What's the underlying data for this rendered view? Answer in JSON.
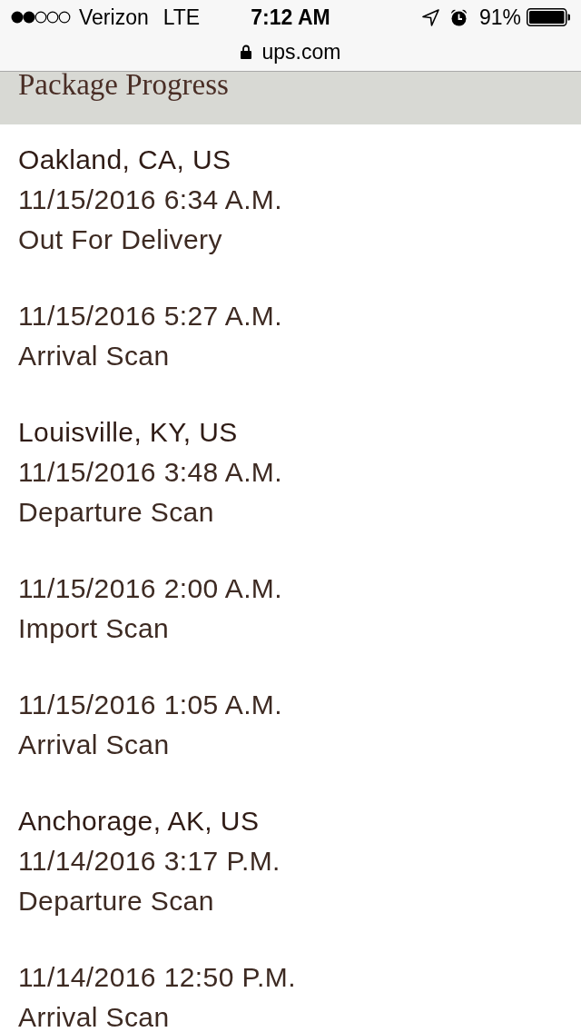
{
  "status_bar": {
    "carrier": "Verizon",
    "network": "LTE",
    "time": "7:12 AM",
    "battery": "91%"
  },
  "address_bar": {
    "url": "ups.com"
  },
  "section": {
    "title": "Package Progress"
  },
  "events": [
    {
      "location": "Oakland, CA, US",
      "datetime": "11/15/2016 6:34 A.M.",
      "status": "Out For Delivery"
    },
    {
      "datetime": "11/15/2016 5:27 A.M.",
      "status": "Arrival Scan"
    },
    {
      "location": "Louisville, KY, US",
      "datetime": "11/15/2016 3:48 A.M.",
      "status": "Departure Scan"
    },
    {
      "datetime": "11/15/2016 2:00 A.M.",
      "status": "Import Scan"
    },
    {
      "datetime": "11/15/2016 1:05 A.M.",
      "status": "Arrival Scan"
    },
    {
      "location": "Anchorage, AK, US",
      "datetime": "11/14/2016 3:17 P.M.",
      "status": "Departure Scan"
    },
    {
      "datetime": "11/14/2016 12:50 P.M.",
      "status": "Arrival Scan"
    }
  ]
}
